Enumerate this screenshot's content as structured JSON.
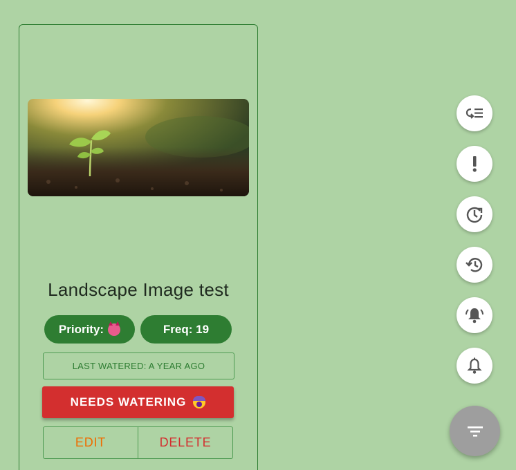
{
  "plant": {
    "name": "Landscape Image test",
    "priority_label": "Priority:",
    "priority_icon": "smiling-devil-emoji",
    "frequency_label": "Freq: 19",
    "last_watered": "LAST WATERED: A YEAR AGO",
    "needs_watering_label": "NEEDS WATERING",
    "needs_watering_icon": "screaming-face-emoji",
    "edit_label": "EDIT",
    "delete_label": "DELETE"
  },
  "fab_menu": {
    "items": [
      {
        "icon": "sort-by-name-icon"
      },
      {
        "icon": "priority-exclamation-icon"
      },
      {
        "icon": "next-watering-clock-icon"
      },
      {
        "icon": "history-icon"
      },
      {
        "icon": "notifications-active-icon"
      },
      {
        "icon": "notifications-icon"
      }
    ],
    "main_icon": "sort-filter-icon"
  },
  "colors": {
    "background": "#aed3a4",
    "primary_green": "#2e7d32",
    "danger_red": "#d32f2f",
    "edit_orange": "#ef6c00",
    "fab_grey": "#9e9e9e"
  }
}
